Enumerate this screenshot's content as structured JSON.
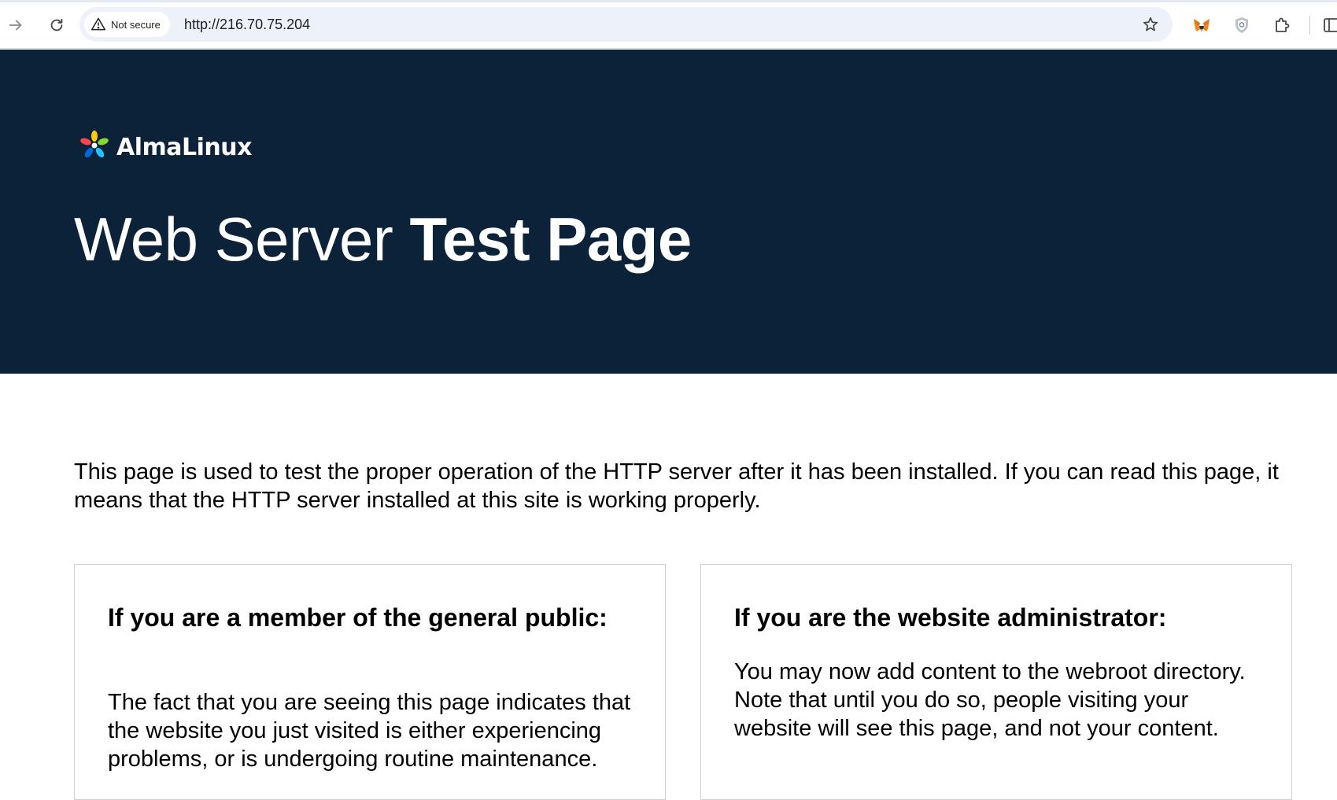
{
  "browser": {
    "security_label": "Not secure",
    "url": "http://216.70.75.204",
    "icons": {
      "forward": "arrow-right-icon",
      "reload": "reload-icon",
      "security": "warning-triangle-icon",
      "bookmark": "star-icon",
      "extension_1": "fox-icon",
      "extension_2": "shield-icon",
      "extensions_menu": "puzzle-icon",
      "side_panel": "side-panel-icon"
    }
  },
  "page": {
    "logo_text": "AlmaLinux",
    "title_regular": "Web Server ",
    "title_bold": "Test Page",
    "intro": "This page is used to test the proper operation of the HTTP server after it has been installed. If you can read this page, it means that the HTTP server installed at this site is working properly.",
    "cards": [
      {
        "heading": "If you are a member of the general public:",
        "body": "The fact that you are seeing this page indicates that the website you just visited is either experiencing problems, or is undergoing routine maintenance."
      },
      {
        "heading": "If you are the website administrator:",
        "body": "You may now add content to the webroot directory. Note that until you do so, people visiting your website will see this page, and not your content."
      }
    ],
    "colors": {
      "hero_background": "#0b2238",
      "hero_text": "#ffffff",
      "body_text": "#000000"
    }
  }
}
